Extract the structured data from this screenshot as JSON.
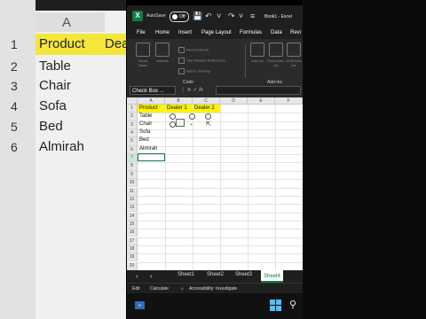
{
  "background": {
    "header_cells": [
      "A"
    ],
    "zoomed_header": [
      "Product",
      "Dea"
    ],
    "zoomed_rows": [
      "Table",
      "Chair",
      "Sofa",
      "Bed",
      "Almirah"
    ],
    "zoomed_row_numbers": [
      "1",
      "2",
      "3",
      "4",
      "5",
      "6"
    ]
  },
  "titlebar": {
    "autosave_label": "AutoSave",
    "toggle_state": "Off",
    "book_title": "Book1 - Excel"
  },
  "menu": {
    "items": [
      "File",
      "Home",
      "Insert",
      "Page Layout",
      "Formulas",
      "Data",
      "Revi"
    ]
  },
  "ribbon": {
    "code_buttons": [
      "Visual Basic",
      "Macros"
    ],
    "code_small": [
      "Record Macro",
      "Use Relative References",
      "Macro Security"
    ],
    "addin_buttons": [
      "Add-ins",
      "Excel Add-ins",
      "COM Add-ins"
    ],
    "group_code": "Code",
    "group_addins": "Add-ins"
  },
  "formula_bar": {
    "name_box": "Check Box ...",
    "fx_label": "fx",
    "formula_value": ""
  },
  "sheet": {
    "columns": [
      "A",
      "B",
      "C",
      "D",
      "E",
      "F"
    ],
    "rows": [
      "1",
      "2",
      "3",
      "4",
      "5",
      "6",
      "7",
      "8",
      "9",
      "10",
      "11",
      "12",
      "13",
      "14",
      "15",
      "16",
      "17",
      "18",
      "19",
      "20"
    ],
    "a1": "Product",
    "b1": "Dealer 1",
    "c1": "Dealer 2",
    "a2": "Table",
    "a3": "Chair",
    "a4": "Sofa",
    "a5": "Bed",
    "a6": "Almirah",
    "highlight_color": "#fff200",
    "selected_cell": "A7"
  },
  "tabs": {
    "sheets": [
      "Sheet1",
      "Sheet2",
      "Sheet3",
      "Sheet4"
    ],
    "active": "Sheet4"
  },
  "status": {
    "mode": "Edit",
    "calc": "Calculate",
    "accessibility": "Accessibility: Investigate"
  },
  "colors": {
    "excel_green": "#107c41",
    "ribbon_bg": "#2b2b2b",
    "header_yellow": "#fff200"
  }
}
